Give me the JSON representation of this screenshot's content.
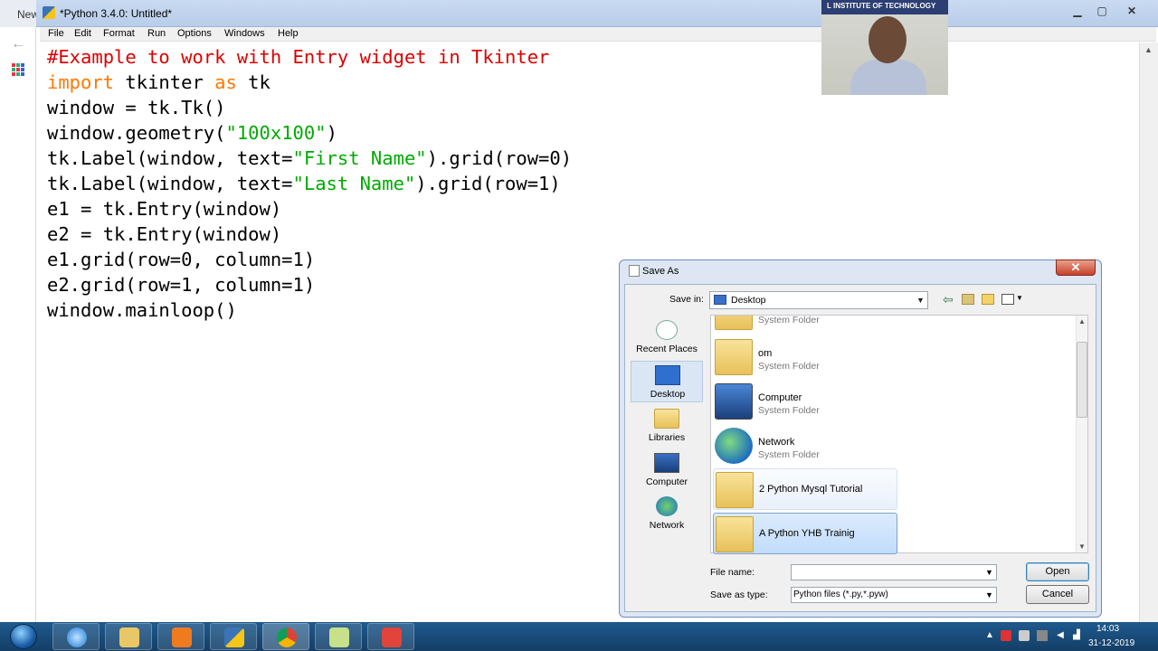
{
  "browser": {
    "tab_label": "New"
  },
  "idle": {
    "title": "*Python 3.4.0: Untitled*",
    "menu": [
      "File",
      "Edit",
      "Format",
      "Run",
      "Options",
      "Windows",
      "Help"
    ],
    "code": {
      "l1": "#Example to work with Entry widget in Tkinter",
      "l2_kw1": "import",
      "l2_mid": " tkinter ",
      "l2_kw2": "as",
      "l2_end": " tk",
      "l3": "window = tk.Tk()",
      "l4_a": "window.geometry(",
      "l4_s": "\"100x100\"",
      "l4_b": ")",
      "l5_a": "tk.Label(window, text=",
      "l5_s": "\"First Name\"",
      "l5_b": ").grid(row=0)",
      "l6_a": "tk.Label(window, text=",
      "l6_s": "\"Last Name\"",
      "l6_b": ").grid(row=1)",
      "l7": "e1 = tk.Entry(window)",
      "l8": "e2 = tk.Entry(window)",
      "l9": "e1.grid(row=0, column=1)",
      "l10": "e2.grid(row=1, column=1)",
      "l11": "window.mainloop()"
    }
  },
  "webcam": {
    "sign_text": "L INSTITUTE OF TECHNOLOGY"
  },
  "dialog": {
    "title": "Save As",
    "save_in_label": "Save in:",
    "save_in_value": "Desktop",
    "places": [
      "Recent Places",
      "Desktop",
      "Libraries",
      "Computer",
      "Network"
    ],
    "items": [
      {
        "name": "",
        "sub": "System Folder"
      },
      {
        "name": "om",
        "sub": "System Folder"
      },
      {
        "name": "Computer",
        "sub": "System Folder"
      },
      {
        "name": "Network",
        "sub": "System Folder"
      },
      {
        "name": "2 Python Mysql Tutorial",
        "sub": ""
      },
      {
        "name": "A Python YHB Trainig",
        "sub": ""
      }
    ],
    "file_name_label": "File name:",
    "file_name_value": "",
    "save_type_label": "Save as type:",
    "save_type_value": "Python files (*.py,*.pyw)",
    "open_label": "Open",
    "cancel_label": "Cancel"
  },
  "taskbar": {
    "clock_time": "14:03",
    "clock_date": "31-12-2019",
    "apps": [
      "internet-explorer",
      "file-explorer",
      "media-player",
      "python-idle",
      "chrome",
      "notes",
      "pdf-tool"
    ]
  }
}
